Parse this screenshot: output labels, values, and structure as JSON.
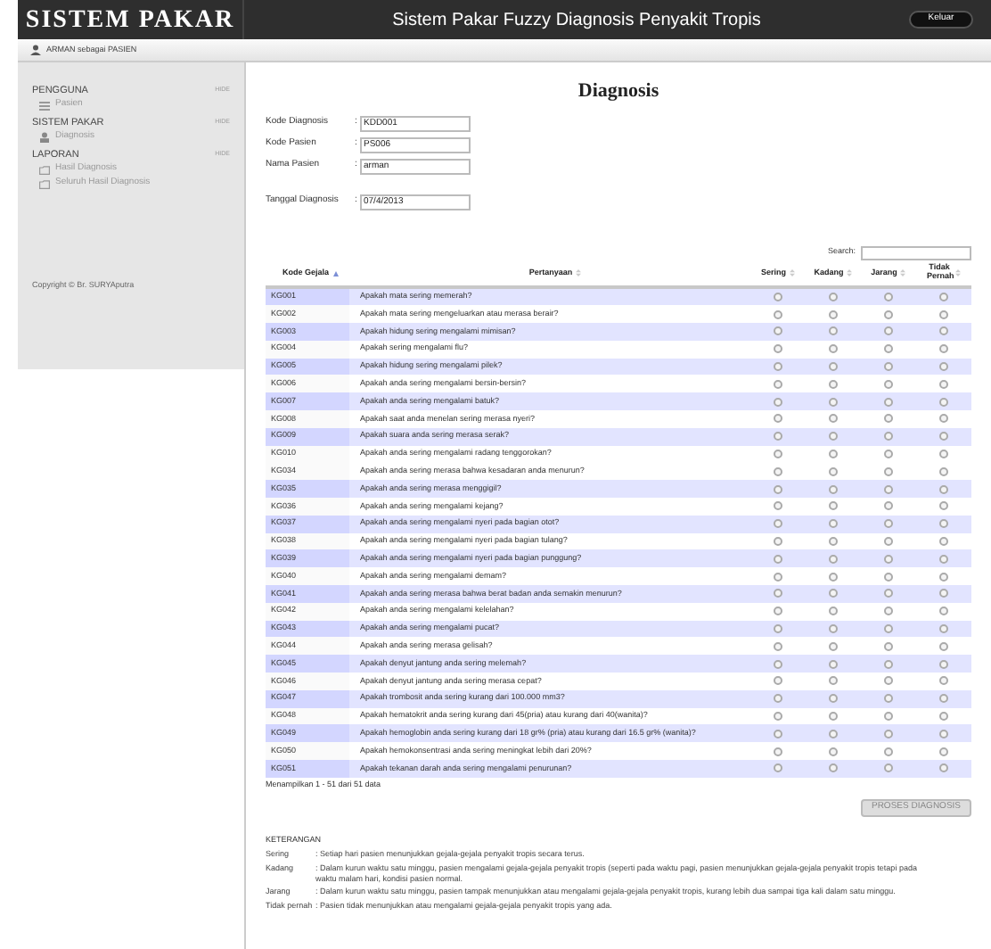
{
  "header": {
    "logo": "SISTEM PAKAR",
    "title": "Sistem Pakar Fuzzy Diagnosis Penyakit Tropis",
    "logout": "Keluar"
  },
  "user_bar": {
    "text": "ARMAN sebagai PASIEN"
  },
  "sidebar": {
    "sections": [
      {
        "title": "PENGGUNA",
        "toggle": "HIDE",
        "items": [
          {
            "label": "Pasien",
            "kind": "list"
          }
        ]
      },
      {
        "title": "SISTEM PAKAR",
        "toggle": "HIDE",
        "items": [
          {
            "label": "Diagnosis",
            "kind": "user"
          }
        ]
      },
      {
        "title": "LAPORAN",
        "toggle": "HIDE",
        "items": [
          {
            "label": "Hasil Diagnosis",
            "kind": "folder"
          },
          {
            "label": "Seluruh Hasil Diagnosis",
            "kind": "folder"
          }
        ]
      }
    ],
    "copyright": "Copyright © Br. SURYAputra"
  },
  "page_title": "Diagnosis",
  "form": [
    {
      "label": "Kode Diagnosis",
      "separator": ":",
      "value": "KDD001"
    },
    {
      "label": "Kode Pasien",
      "separator": ":",
      "value": "PS006"
    },
    {
      "label": "Nama Pasien",
      "separator": ":",
      "value": "arman"
    },
    {
      "label": "Tanggal Diagnosis",
      "separator": ":",
      "value": "07/4/2013"
    }
  ],
  "search": {
    "label": "Search:"
  },
  "table": {
    "columns": [
      {
        "label": "Kode Gejala",
        "sorted": true
      },
      {
        "label": "Pertanyaan",
        "sorted": false
      },
      {
        "label": "Sering",
        "sorted": false
      },
      {
        "label": "Kadang",
        "sorted": false
      },
      {
        "label": "Jarang",
        "sorted": false
      },
      {
        "label": "Tidak Pernah",
        "sorted": false
      }
    ],
    "rows": [
      {
        "code": "KG001",
        "question": "Apakah mata sering memerah?",
        "shaded": true
      },
      {
        "code": "KG002",
        "question": "Apakah mata sering mengeluarkan atau merasa berair?",
        "shaded": false
      },
      {
        "code": "KG003",
        "question": "Apakah hidung sering mengalami mimisan?",
        "shaded": true
      },
      {
        "code": "KG004",
        "question": "Apakah sering mengalami flu?",
        "shaded": false
      },
      {
        "code": "KG005",
        "question": "Apakah hidung sering mengalami pilek?",
        "shaded": true
      },
      {
        "code": "KG006",
        "question": "Apakah anda sering mengalami bersin-bersin?",
        "shaded": false
      },
      {
        "code": "KG007",
        "question": "Apakah anda sering mengalami batuk?",
        "shaded": true
      },
      {
        "code": "KG008",
        "question": "Apakah saat anda menelan sering merasa nyeri?",
        "shaded": false
      },
      {
        "code": "KG009",
        "question": "Apakah suara anda sering merasa serak?",
        "shaded": true
      },
      {
        "code": "KG010",
        "question": "Apakah anda sering mengalami radang tenggorokan?",
        "shaded": false
      },
      {
        "code": "KG034",
        "question": "Apakah anda sering merasa bahwa kesadaran anda menurun?",
        "shaded": false
      },
      {
        "code": "KG035",
        "question": "Apakah anda sering merasa menggigil?",
        "shaded": true
      },
      {
        "code": "KG036",
        "question": "Apakah anda sering mengalami kejang?",
        "shaded": false
      },
      {
        "code": "KG037",
        "question": "Apakah anda sering mengalami nyeri pada bagian otot?",
        "shaded": true
      },
      {
        "code": "KG038",
        "question": "Apakah anda sering mengalami nyeri pada bagian tulang?",
        "shaded": false
      },
      {
        "code": "KG039",
        "question": "Apakah anda sering mengalami nyeri pada bagian punggung?",
        "shaded": true
      },
      {
        "code": "KG040",
        "question": "Apakah anda sering mengalami demam?",
        "shaded": false
      },
      {
        "code": "KG041",
        "question": "Apakah anda sering merasa bahwa berat badan anda semakin menurun?",
        "shaded": true
      },
      {
        "code": "KG042",
        "question": "Apakah anda sering mengalami kelelahan?",
        "shaded": false
      },
      {
        "code": "KG043",
        "question": "Apakah anda sering mengalami pucat?",
        "shaded": true
      },
      {
        "code": "KG044",
        "question": "Apakah anda sering merasa gelisah?",
        "shaded": false
      },
      {
        "code": "KG045",
        "question": "Apakah denyut jantung anda sering melemah?",
        "shaded": true
      },
      {
        "code": "KG046",
        "question": "Apakah denyut jantung anda sering merasa cepat?",
        "shaded": false
      },
      {
        "code": "KG047",
        "question": "Apakah trombosit anda sering kurang dari 100.000 mm3?",
        "shaded": true
      },
      {
        "code": "KG048",
        "question": "Apakah hematokrit anda sering kurang dari 45(pria) atau kurang dari 40(wanita)?",
        "shaded": false
      },
      {
        "code": "KG049",
        "question": "Apakah hemoglobin anda sering kurang dari 18 gr% (pria) atau kurang dari 16.5 gr% (wanita)?",
        "shaded": true
      },
      {
        "code": "KG050",
        "question": "Apakah hemokonsentrasi anda sering meningkat lebih dari 20%?",
        "shaded": false
      },
      {
        "code": "KG051",
        "question": "Apakah tekanan darah anda sering mengalami penurunan?",
        "shaded": true
      }
    ],
    "info": "Menampilkan 1 - 51 dari 51 data"
  },
  "submit": "PROSES DIAGNOSIS",
  "legend": {
    "title": "KETERANGAN",
    "items": [
      {
        "term": "Sering",
        "text": ": Setiap hari pasien menunjukkan gejala-gejala penyakit tropis secara terus."
      },
      {
        "term": "Kadang",
        "text": ": Dalam kurun waktu satu minggu, pasien mengalami gejala-gejala penyakit tropis (seperti pada waktu pagi, pasien menunjukkan gejala-gejala penyakit tropis tetapi pada waktu malam hari, kondisi pasien normal."
      },
      {
        "term": "Jarang",
        "text": ": Dalam kurun waktu satu minggu, pasien tampak menunjukkan atau mengalami gejala-gejala penyakit tropis, kurang lebih dua sampai tiga kali dalam satu minggu."
      },
      {
        "term": "Tidak pernah",
        "text": ": Pasien tidak menunjukkan atau mengalami gejala-gejala penyakit tropis yang ada."
      }
    ]
  }
}
